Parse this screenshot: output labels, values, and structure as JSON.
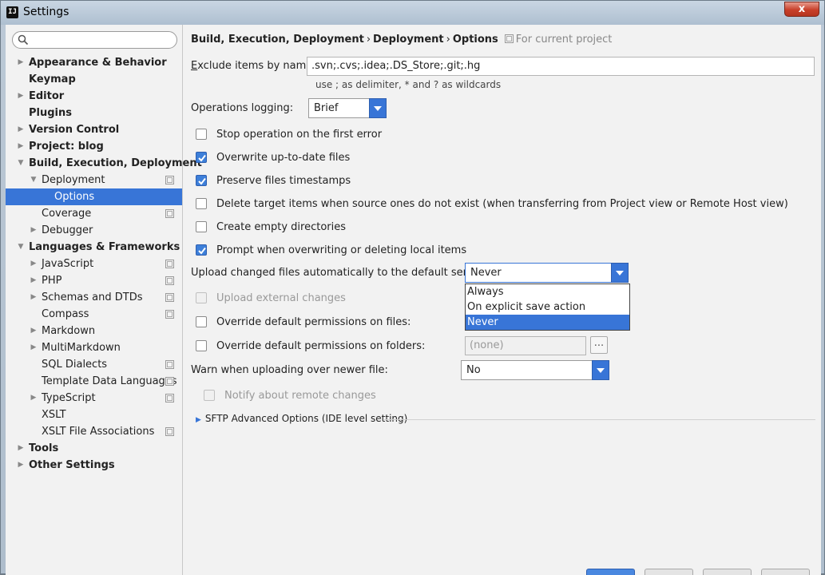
{
  "window": {
    "title": "Settings",
    "app_icon_text": "IJ",
    "close_glyph": "x"
  },
  "search": {
    "placeholder": "",
    "value": ""
  },
  "sidebar": {
    "items": [
      {
        "label": "Appearance & Behavior",
        "bold": true,
        "expander": "collapsed"
      },
      {
        "label": "Keymap",
        "bold": true,
        "expander": "none"
      },
      {
        "label": "Editor",
        "bold": true,
        "expander": "collapsed"
      },
      {
        "label": "Plugins",
        "bold": true,
        "expander": "none"
      },
      {
        "label": "Version Control",
        "bold": true,
        "expander": "collapsed"
      },
      {
        "label": "Project: blog",
        "bold": true,
        "expander": "collapsed"
      },
      {
        "label": "Build, Execution, Deployment",
        "bold": true,
        "expander": "expanded"
      },
      {
        "label": "Deployment",
        "bold": false,
        "expander": "expanded",
        "project_icon": true
      },
      {
        "label": "Options",
        "bold": false,
        "expander": "none",
        "selected": true
      },
      {
        "label": "Coverage",
        "bold": false,
        "expander": "none",
        "project_icon": true
      },
      {
        "label": "Debugger",
        "bold": false,
        "expander": "collapsed"
      },
      {
        "label": "Languages & Frameworks",
        "bold": true,
        "expander": "expanded"
      },
      {
        "label": "JavaScript",
        "bold": false,
        "expander": "collapsed",
        "project_icon": true
      },
      {
        "label": "PHP",
        "bold": false,
        "expander": "collapsed",
        "project_icon": true
      },
      {
        "label": "Schemas and DTDs",
        "bold": false,
        "expander": "collapsed",
        "project_icon": true
      },
      {
        "label": "Compass",
        "bold": false,
        "expander": "none",
        "project_icon": true
      },
      {
        "label": "Markdown",
        "bold": false,
        "expander": "collapsed"
      },
      {
        "label": "MultiMarkdown",
        "bold": false,
        "expander": "collapsed"
      },
      {
        "label": "SQL Dialects",
        "bold": false,
        "expander": "none",
        "project_icon": true
      },
      {
        "label": "Template Data Languages",
        "bold": false,
        "expander": "none",
        "project_icon": true
      },
      {
        "label": "TypeScript",
        "bold": false,
        "expander": "collapsed",
        "project_icon": true
      },
      {
        "label": "XSLT",
        "bold": false,
        "expander": "none"
      },
      {
        "label": "XSLT File Associations",
        "bold": false,
        "expander": "none",
        "project_icon": true
      },
      {
        "label": "Tools",
        "bold": true,
        "expander": "collapsed"
      },
      {
        "label": "Other Settings",
        "bold": true,
        "expander": "collapsed"
      }
    ]
  },
  "breadcrumb": {
    "part1": "Build, Execution, Deployment",
    "part2": "Deployment",
    "part3": "Options",
    "separator": "›",
    "scope": "For current project"
  },
  "exclude": {
    "label": "Exclude items by name:",
    "value": ".svn;.cvs;.idea;.DS_Store;.git;.hg",
    "hint": "use ; as delimiter, * and ? as wildcards"
  },
  "operations_logging": {
    "label": "Operations logging:",
    "value": "Brief"
  },
  "checkboxes": {
    "stop_on_error": {
      "label": "Stop operation on the first error",
      "checked": false
    },
    "overwrite_up_to_date": {
      "label": "Overwrite up-to-date files",
      "checked": true
    },
    "preserve_timestamps": {
      "label": "Preserve files timestamps",
      "checked": true
    },
    "delete_target": {
      "label": "Delete target items when source ones do not exist (when transferring from Project view or Remote Host view)",
      "checked": false
    },
    "create_empty_dirs": {
      "label": "Create empty directories",
      "checked": false
    },
    "prompt_overwrite": {
      "label": "Prompt when overwriting or deleting local items",
      "checked": true
    },
    "upload_external": {
      "label": "Upload external changes",
      "checked": false,
      "disabled": true
    },
    "override_files": {
      "label": "Override default permissions on files:",
      "checked": false
    },
    "override_folders": {
      "label": "Override default permissions on folders:",
      "checked": false
    },
    "notify_remote": {
      "label": "Notify about remote changes",
      "checked": false,
      "disabled": true
    }
  },
  "upload_auto": {
    "label": "Upload changed files automatically to the default server",
    "value": "Never",
    "options": [
      "Always",
      "On explicit save action (Ctrl+S)",
      "Never"
    ],
    "selected_option": "Never"
  },
  "folder_permissions": {
    "placeholder": "(none)",
    "browse_label": "..."
  },
  "warn_newer": {
    "label": "Warn when uploading over newer file:",
    "value": "No"
  },
  "sftp": {
    "label": "SFTP Advanced Options (IDE level setting)"
  },
  "colors": {
    "accent": "#3875d7",
    "check": "#3d7fd9",
    "panel": "#f2f2f2"
  }
}
